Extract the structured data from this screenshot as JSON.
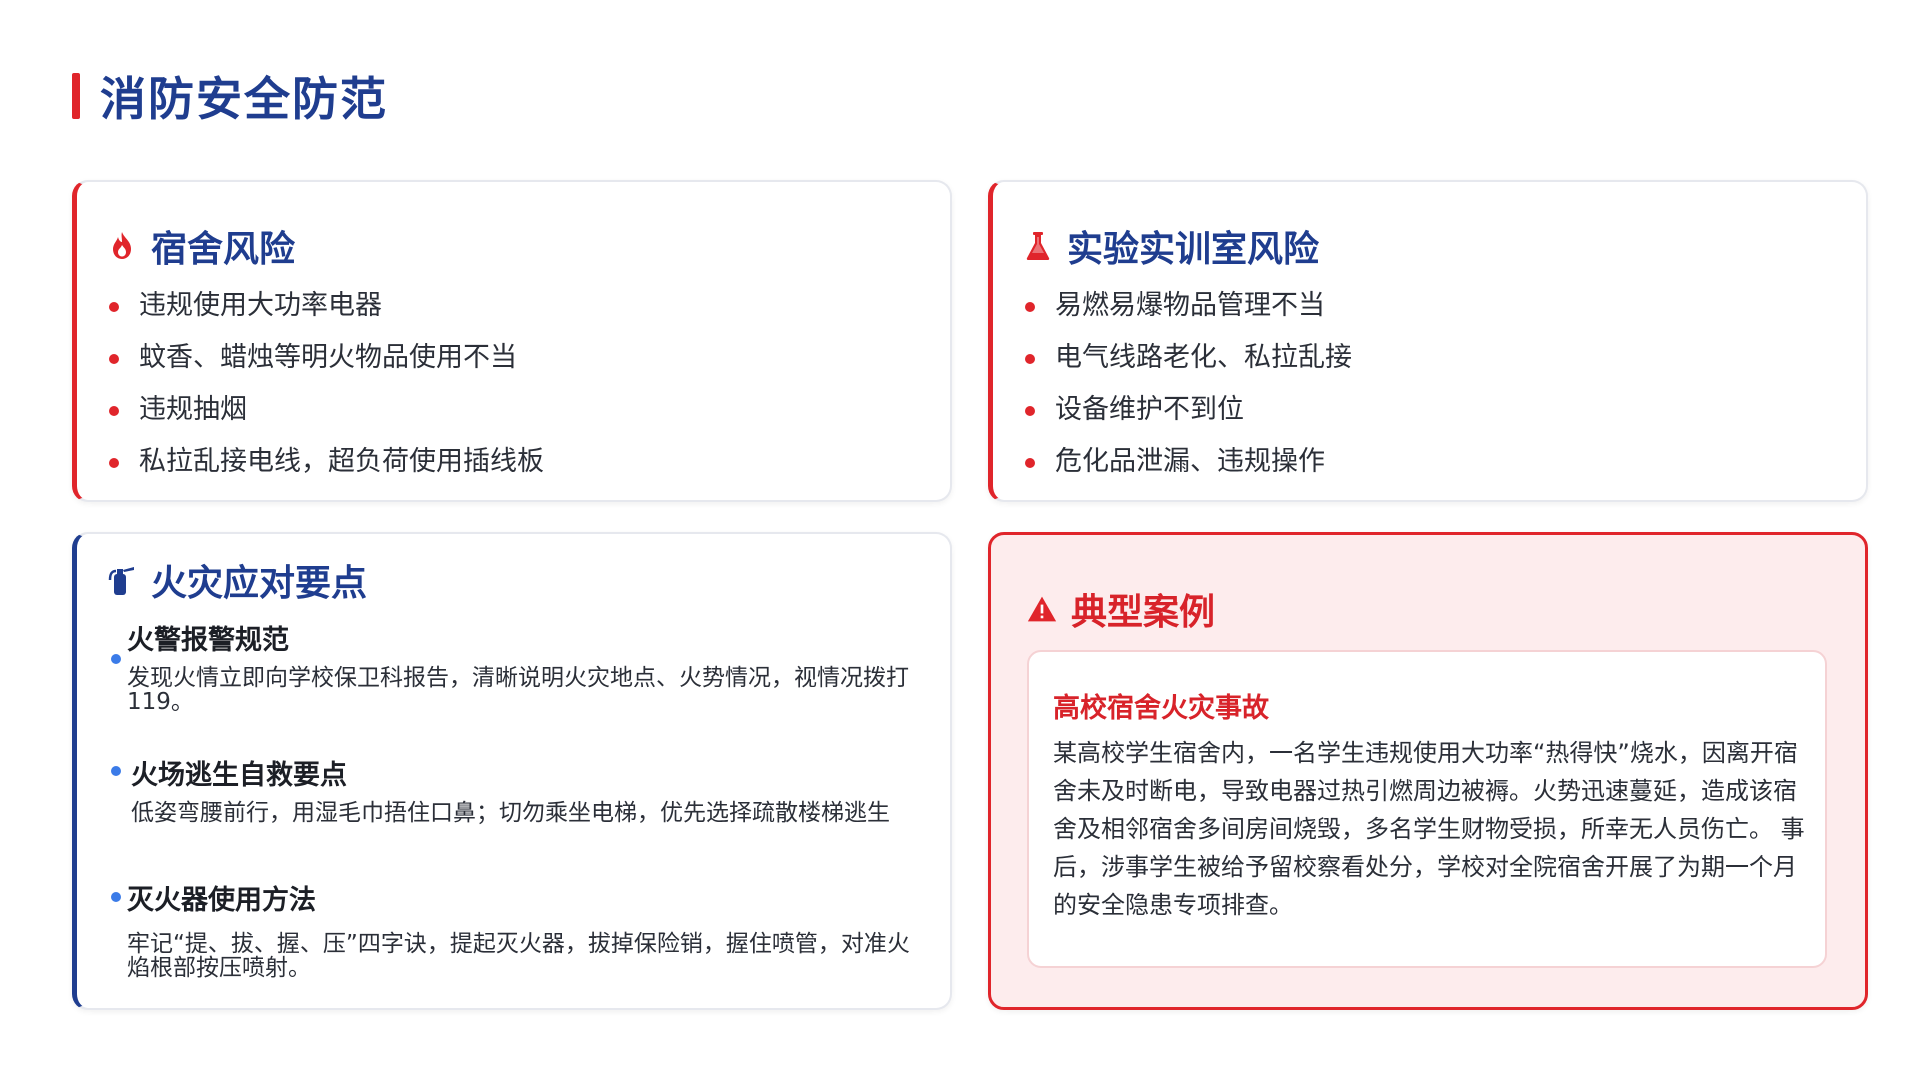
{
  "page": {
    "title": "消防安全防范"
  },
  "colors": {
    "accent_red": "#e0252b",
    "title_navy": "#1f3d8f",
    "bullet_blue": "#3b7be8",
    "case_bg": "#fdeced"
  },
  "dorm": {
    "icon": "fire-icon",
    "title": "宿舍风险",
    "items": [
      "违规使用大功率电器",
      "蚊香、蜡烛等明火物品使用不当",
      "违规抽烟",
      "私拉乱接电线，超负荷使用插线板"
    ]
  },
  "lab": {
    "icon": "flask-icon",
    "title": "实验实训室风险",
    "items": [
      "易燃易爆物品管理不当",
      "电气线路老化、私拉乱接",
      "设备维护不到位",
      "危化品泄漏、违规操作"
    ]
  },
  "response": {
    "icon": "fire-extinguisher-icon",
    "title": "火灾应对要点",
    "items": [
      {
        "title": "火警报警规范",
        "body": "发现火情立即向学校保卫科报告，清晰说明火灾地点、火势情况，视情况拨打119。"
      },
      {
        "title": "火场逃生自救要点",
        "body": "低姿弯腰前行，用湿毛巾捂住口鼻；切勿乘坐电梯，优先选择疏散楼梯逃生"
      },
      {
        "title": "灭火器使用方法",
        "body": "牢记“提、拔、握、压”四字诀，提起灭火器，拔掉保险销，握住喷管，对准火焰根部按压喷射。"
      }
    ]
  },
  "case": {
    "icon": "warning-triangle-icon",
    "title": "典型案例",
    "subtitle": "高校宿舍火灾事故",
    "text": " 某高校学生宿舍内，一名学生违规使用大功率“热得快”烧水，因离开宿舍未及时断电，导致电器过热引燃周边被褥。火势迅速蔓延，造成该宿舍及相邻宿舍多间房间烧毁，多名学生财物受损，所幸无人员伤亡。 事后，涉事学生被给予留校察看处分，学校对全院宿舍开展了为期一个月的安全隐患专项排查。"
  }
}
